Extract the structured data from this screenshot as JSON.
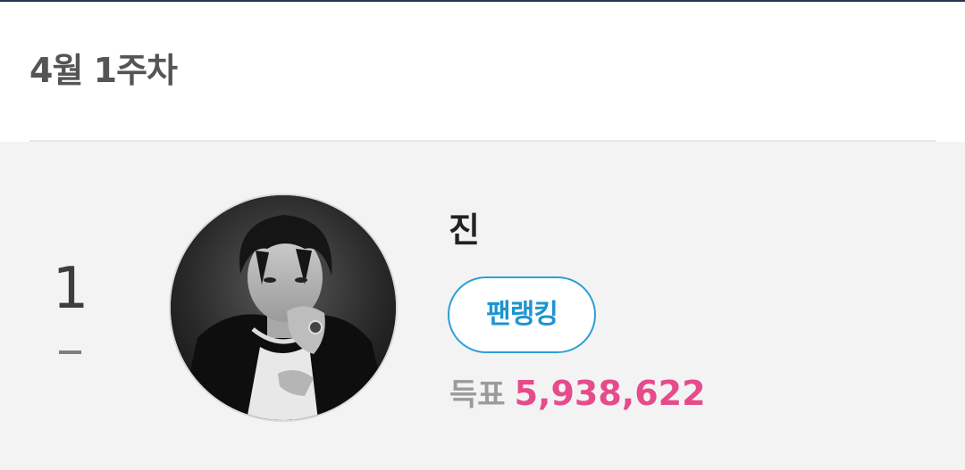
{
  "header": {
    "week_title": "4월 1주차"
  },
  "ranking": {
    "rank": "1",
    "rank_change": "–",
    "artist_name": "진",
    "fan_ranking_button": "팬랭킹",
    "votes_label": "득표",
    "votes_value": "5,938,622"
  },
  "colors": {
    "accent_blue": "#1c95d0",
    "votes_pink": "#e64b8c",
    "card_background": "#f3f3f3"
  },
  "icons": {
    "avatar": "artist-photo"
  }
}
